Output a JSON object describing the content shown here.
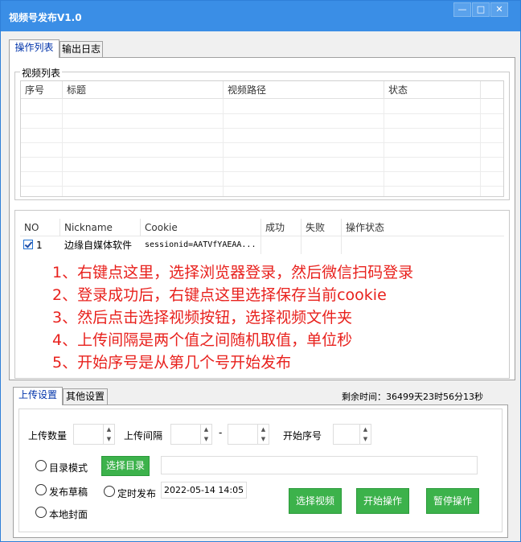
{
  "window": {
    "title": "视频号发布V1.0",
    "controls": [
      "—",
      "□",
      "✕"
    ]
  },
  "tabs": [
    {
      "label": "操作列表",
      "active": true
    },
    {
      "label": "输出日志",
      "active": false
    }
  ],
  "video_list": {
    "group_label": "视频列表",
    "columns": [
      "序号",
      "标题",
      "视频路径",
      "状态"
    ]
  },
  "account_list": {
    "columns": [
      "NO",
      "Nickname",
      "Cookie",
      "成功",
      "失败",
      "操作状态"
    ],
    "rows": [
      {
        "checked": true,
        "no": "1",
        "nickname": "边缘自媒体软件",
        "cookie": "sessionid=AATVfYAEAA...",
        "success": "",
        "fail": "",
        "status": ""
      }
    ]
  },
  "annotations": [
    "1、右键点这里，选择浏览器登录，然后微信扫码登录",
    "2、登录成功后，右键点这里选择保存当前cookie",
    "3、然后点击选择视频按钮，选择视频文件夹",
    "4、上传间隔是两个值之间随机取值，单位秒",
    "5、开始序号是从第几个号开始发布"
  ],
  "bottom_tabs": [
    {
      "label": "上传设置",
      "active": true
    },
    {
      "label": "其他设置",
      "active": false
    }
  ],
  "countdown": "剩余时间：36499天23时56分13秒",
  "upload_settings": {
    "upload_count_label": "上传数量",
    "upload_interval_label": "上传间隔",
    "interval_dash": "-",
    "start_index_label": "开始序号",
    "directory_mode_label": "目录模式",
    "select_dir_button": "选择目录",
    "directory_value": "",
    "publish_draft_label": "发布草稿",
    "scheduled_publish_label": "定时发布",
    "scheduled_time": "2022-05-14  14:05",
    "local_cover_label": "本地封面",
    "select_video_button": "选择视频",
    "start_button": "开始操作",
    "pause_button": "暂停操作"
  },
  "colors": {
    "titlebar": "#3a8ee6",
    "accent_tab_text": "#0033aa",
    "annotation": "#e8211d",
    "button_green": "#3cb24b"
  }
}
